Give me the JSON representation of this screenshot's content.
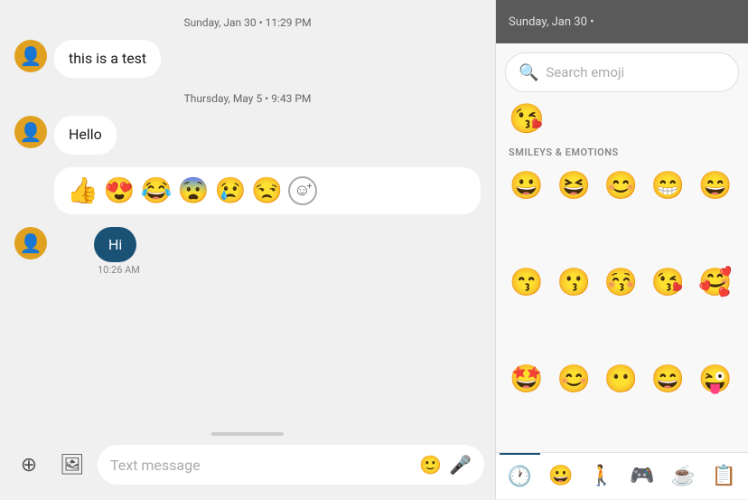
{
  "chat": {
    "date1": "Sunday, Jan 30 • 11:29 PM",
    "message1": "this is a test",
    "date2": "Thursday, May 5 • 9:43 PM",
    "message2": "Hello",
    "emojis": [
      "👍",
      "😍",
      "😂",
      "😨",
      "😢",
      "😒"
    ],
    "emoji_add_label": "☺",
    "sent_message": "Hi",
    "sent_time": "10:26 AM",
    "input_placeholder": "Text message"
  },
  "emoji_panel": {
    "date": "Sunday, Jan 30 •",
    "search_placeholder": "Search emoji",
    "recent_emoji": "😘",
    "section_label": "SMILEYS & EMOTIONS",
    "emojis_row1": [
      "😀",
      "😆",
      "😊",
      "😁",
      "😄"
    ],
    "emojis_row2": [
      "😙",
      "😗",
      "😚",
      "😘",
      "🥰"
    ],
    "emojis_row3": [
      "🤩",
      "😊",
      "😶",
      "😄",
      "😜"
    ],
    "tabs": [
      "🕐",
      "😀",
      "🚶",
      "🎮",
      "☕",
      "📋"
    ]
  }
}
